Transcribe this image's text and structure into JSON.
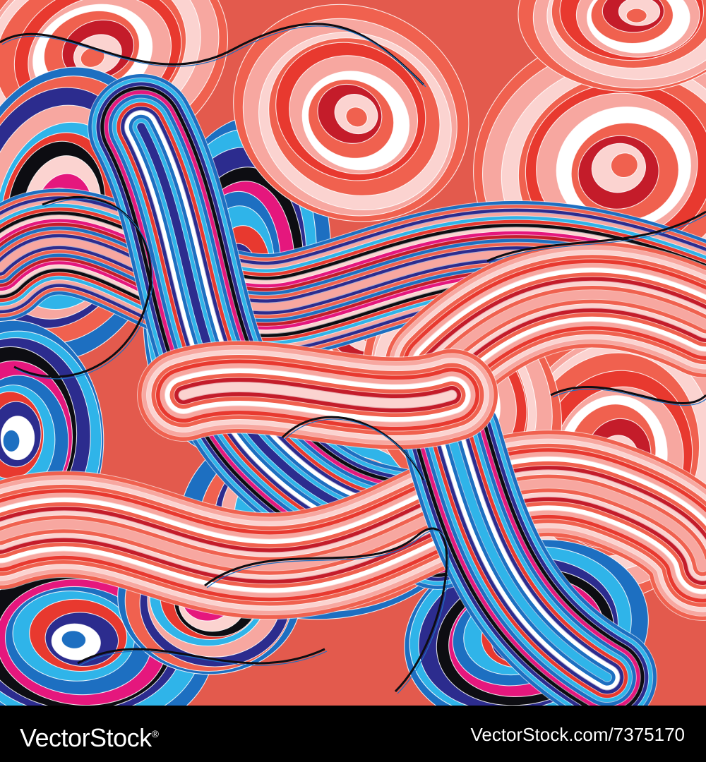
{
  "artwork": {
    "subject": "seamless abstract pattern of striped swirling waves",
    "palette": [
      "#f0614f",
      "#f7a7a0",
      "#fbd3d0",
      "#e8392f",
      "#c41c2a",
      "#1d6fc1",
      "#2fb4e9",
      "#2c2c8e",
      "#e5177d",
      "#0d0d12",
      "#ffffff"
    ]
  },
  "footer": {
    "brand": "VectorStock",
    "registered_mark": "®",
    "image_id": "VectorStock.com/7375170"
  }
}
